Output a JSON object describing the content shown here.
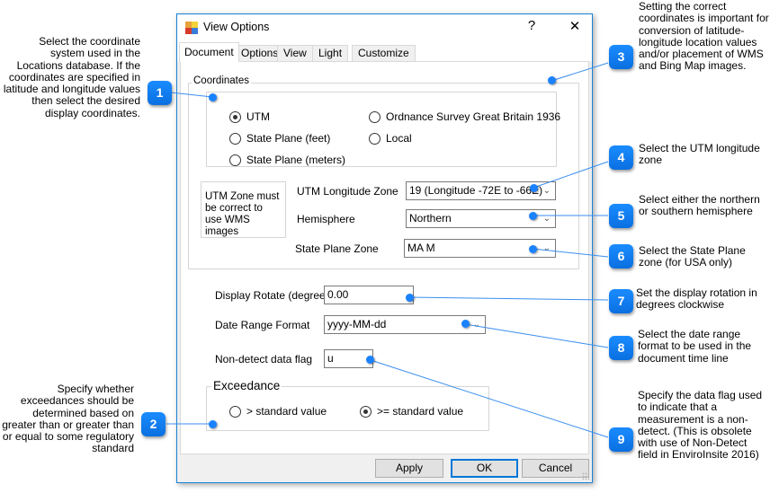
{
  "dialog": {
    "title": "View Options",
    "help_button": "?",
    "close_button": "✕",
    "tabs": [
      {
        "label": "Document",
        "active": true
      },
      {
        "label": "Options",
        "active": false
      },
      {
        "label": "View",
        "active": false
      },
      {
        "label": "Light",
        "active": false
      },
      {
        "label": "Customize",
        "active": false
      }
    ],
    "coordinates": {
      "group_label": "Coordinates",
      "options": [
        {
          "label": "UTM",
          "checked": true
        },
        {
          "label": "State Plane (feet)",
          "checked": false
        },
        {
          "label": "State Plane (meters)",
          "checked": false
        },
        {
          "label": "Ordnance Survey Great Britain 1936",
          "checked": false
        },
        {
          "label": "Local",
          "checked": false
        }
      ],
      "note": "UTM Zone must be correct to use WMS images",
      "utm_zone_label": "UTM Longitude Zone",
      "utm_zone_value": "19 (Longitude -72E to -66E)",
      "hemisphere_label": "Hemisphere",
      "hemisphere_value": "Northern",
      "state_plane_label": "State Plane Zone",
      "state_plane_value": "MA M"
    },
    "display_rotate_label": "Display Rotate (degrees)",
    "display_rotate_value": "0.00",
    "date_format_label": "Date Range Format",
    "date_format_value": "yyyy-MM-dd",
    "nondetect_label": "Non-detect data flag",
    "nondetect_value": "u",
    "exceedance": {
      "group_label": "Exceedance",
      "options": [
        {
          "label": "> standard value",
          "checked": false
        },
        {
          "label": ">= standard value",
          "checked": true
        }
      ]
    },
    "buttons": {
      "apply": "Apply",
      "ok": "OK",
      "cancel": "Cancel"
    }
  },
  "callouts": [
    {
      "number": "1",
      "text": "Select the coordinate system used in the Locations database.  If the coordinates are specified in latitude and longitude values then select the desired display coordinates."
    },
    {
      "number": "2",
      "text": "Specify whether exceedances should be determined based on greater than or greater than or equal to some regulatory standard"
    },
    {
      "number": "3",
      "text": "Setting the correct coordinates is important for conversion of latitude-longitude location values and/or placement of WMS and Bing Map images."
    },
    {
      "number": "4",
      "text": "Select the UTM longitude zone"
    },
    {
      "number": "5",
      "text": "Select either the northern or southern hemisphere"
    },
    {
      "number": "6",
      "text": "Select the State Plane zone (for USA only)"
    },
    {
      "number": "7",
      "text": "Set the display rotation in degrees clockwise"
    },
    {
      "number": "8",
      "text": "Select the date range format to be used in the document time line"
    },
    {
      "number": "9",
      "text": "Specify the data flag used to indicate that a measurement is a non-detect.  (This is obsolete with use of Non-Detect field in EnviroInsite 2016)"
    }
  ],
  "colors": {
    "accent": "#0078d7",
    "callout_badge": "#1a82ff",
    "connector_line": "#3a8ef0"
  }
}
